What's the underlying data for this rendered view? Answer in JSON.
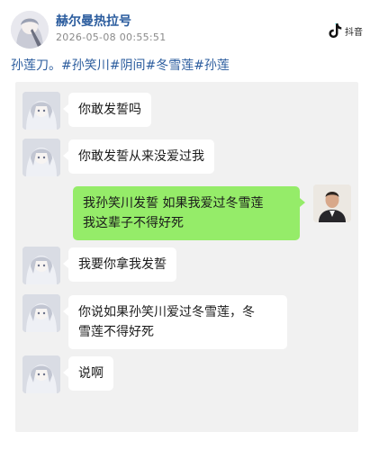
{
  "post": {
    "author": "赫尔曼热拉号",
    "timestamp": "2026-05-08  00:55:51",
    "caption": "孙莲刀。#孙笑川#阴间#冬雪莲#孙莲",
    "logo_text": "抖音"
  },
  "colors": {
    "link": "#2b5c9e",
    "chat_bg": "#f1f1f1",
    "incoming_bubble": "#ffffff",
    "outgoing_bubble": "#95ec69"
  },
  "messages": [
    {
      "side": "in",
      "lines": [
        "你敢发誓吗"
      ]
    },
    {
      "side": "in",
      "lines": [
        "你敢发誓从来没爱过我"
      ]
    },
    {
      "side": "out",
      "lines": [
        "我孙笑川发誓 如果我爱过冬雪莲",
        "我这辈子不得好死"
      ]
    },
    {
      "side": "in",
      "lines": [
        "我要你拿我发誓"
      ]
    },
    {
      "side": "in",
      "lines": [
        "你说如果孙笑川爱过冬雪莲，冬",
        "雪莲不得好死"
      ]
    },
    {
      "side": "in",
      "lines": [
        "说啊"
      ]
    }
  ]
}
